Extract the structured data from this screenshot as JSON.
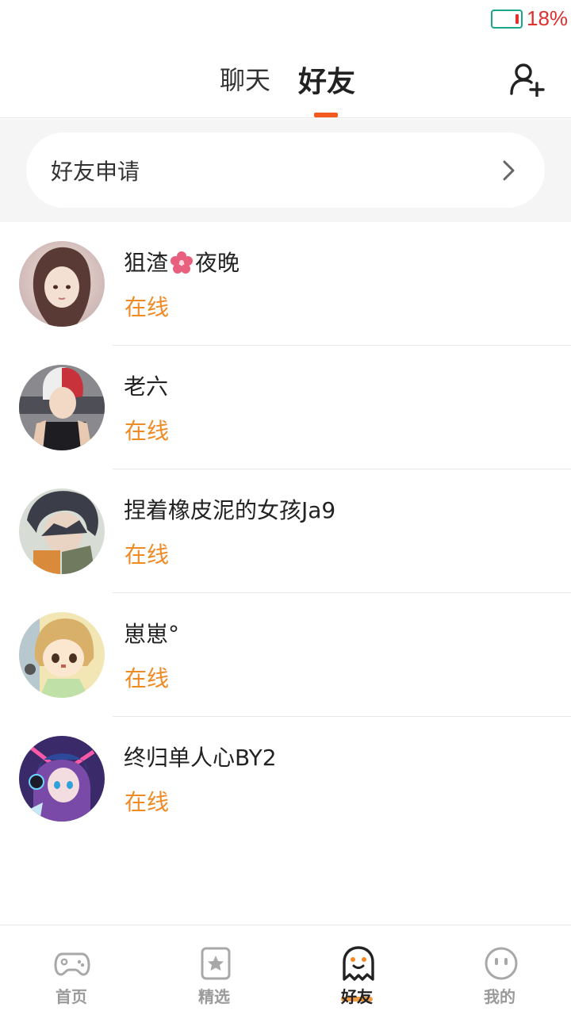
{
  "status_bar": {
    "battery_percent": "18%",
    "battery_color": "#e0302e"
  },
  "header": {
    "tabs": [
      {
        "label": "聊天",
        "active": false
      },
      {
        "label": "好友",
        "active": true
      }
    ],
    "add_friend_icon": "add-user-icon",
    "accent_color": "#f25a1f"
  },
  "friend_request": {
    "label": "好友申请",
    "icon": "chevron-right-icon"
  },
  "friends": [
    {
      "name_part1": "狙渣",
      "name_part2": "夜晚",
      "status": "在线"
    },
    {
      "name": "老六",
      "status": "在线"
    },
    {
      "name": "捏着橡皮泥的女孩Ja9",
      "status": "在线"
    },
    {
      "name": "崽崽°",
      "status": "在线"
    },
    {
      "name": "终归单人心BY2",
      "status": "在线"
    }
  ],
  "status_color": "#f08a24",
  "bottom_nav": [
    {
      "label": "首页",
      "icon": "gamepad-icon"
    },
    {
      "label": "精选",
      "icon": "star-bookmark-icon"
    },
    {
      "label": "好友",
      "icon": "ghost-icon",
      "active": true
    },
    {
      "label": "我的",
      "icon": "face-icon"
    }
  ]
}
